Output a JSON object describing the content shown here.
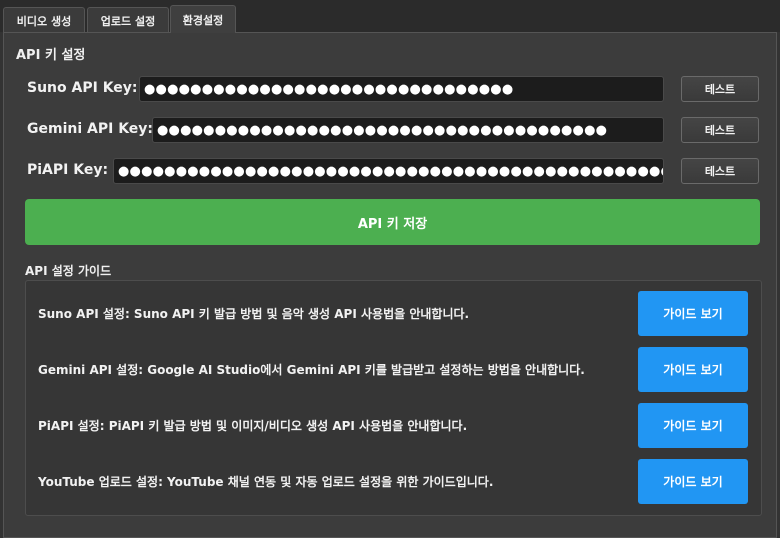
{
  "tabs": [
    "비디오 생성",
    "업로드 설정",
    "환경설정"
  ],
  "active_tab": "환경설정",
  "api_section": {
    "title": "API 키 설정",
    "rows": [
      {
        "label": "Suno API Key:",
        "masked_value": "●●●●●●●●●●●●●●●●●●●●●●●●●●●●●●●●",
        "test_label": "테스트"
      },
      {
        "label": "Gemini API Key:",
        "masked_value": "●●●●●●●●●●●●●●●●●●●●●●●●●●●●●●●●●●●●●●●",
        "test_label": "테스트"
      },
      {
        "label": "PiAPI Key:",
        "masked_value": "●●●●●●●●●●●●●●●●●●●●●●●●●●●●●●●●●●●●●●●●●●●●●●●●●●●●●●●●●●●●●●●●●",
        "test_label": "테스트"
      }
    ],
    "save_label": "API 키 저장"
  },
  "guide_section": {
    "title": "API 설정 가이드",
    "items": [
      {
        "text": "Suno API 설정: Suno API 키 발급 방법 및 음악 생성 API 사용법을 안내합니다.",
        "button": "가이드 보기"
      },
      {
        "text": "Gemini API 설정: Google AI Studio에서 Gemini API 키를 발급받고 설정하는 방법을 안내합니다.",
        "button": "가이드 보기"
      },
      {
        "text": "PiAPI 설정: PiAPI 키 발급 방법 및 이미지/비디오 생성 API 사용법을 안내합니다.",
        "button": "가이드 보기"
      },
      {
        "text": "YouTube 업로드 설정: YouTube 채널 연동 및 자동 업로드 설정을 위한 가이드입니다.",
        "button": "가이드 보기"
      }
    ]
  },
  "colors": {
    "background": "#333333",
    "save_button": "#4caf50",
    "guide_button": "#2196f3",
    "field": "#1c1c1c"
  }
}
